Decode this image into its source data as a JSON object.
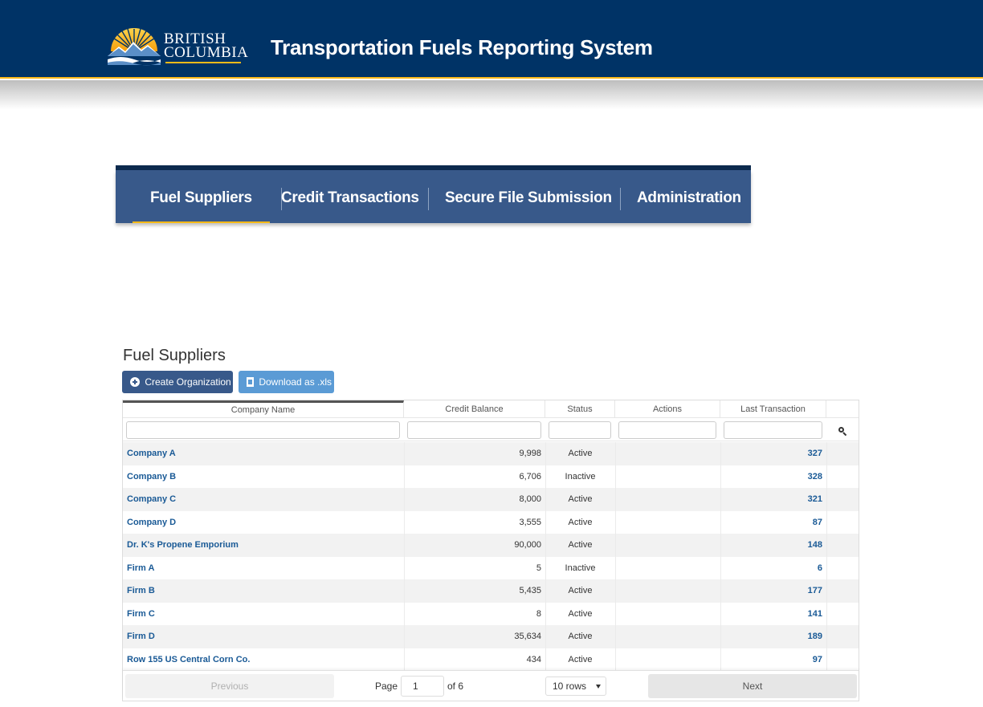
{
  "header": {
    "logo_line1": "BRITISH",
    "logo_line2": "COLUMBIA",
    "app_title": "Transportation Fuels Reporting System"
  },
  "nav": {
    "items": [
      {
        "label": "Fuel Suppliers",
        "active": true
      },
      {
        "label": "Credit Transactions",
        "active": false
      },
      {
        "label": "Secure File Submission",
        "active": false
      },
      {
        "label": "Administration",
        "active": false
      }
    ]
  },
  "page": {
    "title": "Fuel Suppliers",
    "create_button": "Create Organization",
    "download_button": "Download as .xls"
  },
  "table": {
    "columns": [
      "Company Name",
      "Credit Balance",
      "Status",
      "Actions",
      "Last Transaction"
    ],
    "sorted_column": "Company Name",
    "rows": [
      {
        "name": "Company A",
        "balance": "9,998",
        "status": "Active",
        "actions": "",
        "last": "327"
      },
      {
        "name": "Company B",
        "balance": "6,706",
        "status": "Inactive",
        "actions": "",
        "last": "328"
      },
      {
        "name": "Company C",
        "balance": "8,000",
        "status": "Active",
        "actions": "",
        "last": "321"
      },
      {
        "name": "Company D",
        "balance": "3,555",
        "status": "Active",
        "actions": "",
        "last": "87"
      },
      {
        "name": "Dr. K's Propene Emporium",
        "balance": "90,000",
        "status": "Active",
        "actions": "",
        "last": "148"
      },
      {
        "name": "Firm A",
        "balance": "5",
        "status": "Inactive",
        "actions": "",
        "last": "6"
      },
      {
        "name": "Firm B",
        "balance": "5,435",
        "status": "Active",
        "actions": "",
        "last": "177"
      },
      {
        "name": "Firm C",
        "balance": "8",
        "status": "Active",
        "actions": "",
        "last": "141"
      },
      {
        "name": "Firm D",
        "balance": "35,634",
        "status": "Active",
        "actions": "",
        "last": "189"
      },
      {
        "name": "Row 155 US Central Corn Co.",
        "balance": "434",
        "status": "Active",
        "actions": "",
        "last": "97"
      }
    ]
  },
  "pagination": {
    "previous": "Previous",
    "next": "Next",
    "page_label": "Page",
    "page_value": "1",
    "of_label": "of 6",
    "rows_select": "10 rows"
  },
  "colors": {
    "header_bg": "#003366",
    "accent_gold": "#fcba19",
    "nav_bg": "#38598a",
    "link_blue": "#1a5a96",
    "download_btn": "#5b9bd5"
  }
}
